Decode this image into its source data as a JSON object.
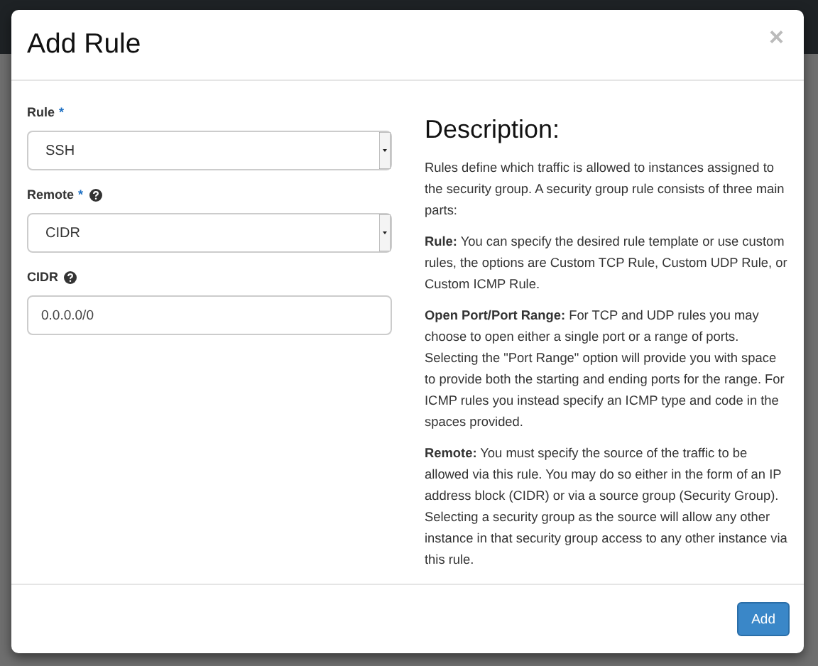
{
  "modal": {
    "title": "Add Rule",
    "close": "×",
    "fields": [
      {
        "kind": "select",
        "label": "Rule",
        "required_mark": "*",
        "help": false,
        "value": "SSH"
      },
      {
        "kind": "select",
        "label": "Remote",
        "required_mark": "*",
        "help": true,
        "value": "CIDR"
      },
      {
        "kind": "text",
        "label": "CIDR",
        "help": true,
        "value": "0.0.0.0/0"
      }
    ],
    "description": {
      "heading": "Description:",
      "paragraphs": [
        "Rules define which traffic is allowed to instances assigned to the security group. A security group rule consists of three main parts:",
        "**Rule:** You can specify the desired rule template or use custom rules, the options are Custom TCP Rule, Custom UDP Rule, or Custom ICMP Rule.",
        "**Open Port/Port Range:** For TCP and UDP rules you may choose to open either a single port or a range of ports. Selecting the \"Port Range\" option will provide you with space to provide both the starting and ending ports for the range. For ICMP rules you instead specify an ICMP type and code in the spaces provided.",
        "**Remote:** You must specify the source of the traffic to be allowed via this rule. You may do so either in the form of an IP address block (CIDR) or via a source group (Security Group). Selecting a security group as the source will allow any other instance in that security group access to any other instance via this rule."
      ]
    },
    "buttons": [
      {
        "label": "Add",
        "kind": "primary"
      }
    ]
  }
}
